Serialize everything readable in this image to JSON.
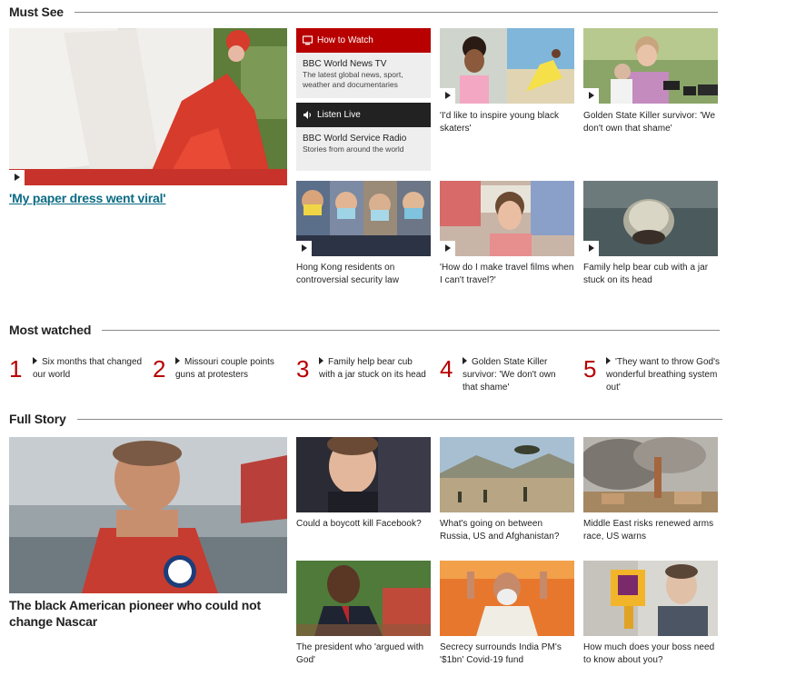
{
  "must_see": {
    "heading": "Must See",
    "feature": {
      "title": "'My paper dress went viral'"
    },
    "how_to_watch": {
      "label": "How to Watch",
      "title": "BBC World News TV",
      "subtitle": "The latest global news, sport, weather and documentaries"
    },
    "listen_live": {
      "label": "Listen Live",
      "title": "BBC World Service Radio",
      "subtitle": "Stories from around the world"
    },
    "items": [
      {
        "caption": "'I'd like to inspire young black skaters'"
      },
      {
        "caption": "Golden State Killer survivor: 'We don't own that shame'"
      },
      {
        "caption": "Hong Kong residents on controversial security law"
      },
      {
        "caption": "'How do I make travel films when I can't travel?'"
      },
      {
        "caption": "Family help bear cub with a jar stuck on its head"
      }
    ]
  },
  "most_watched": {
    "heading": "Most watched",
    "items": [
      {
        "rank": "1",
        "title": "Six months that changed our world"
      },
      {
        "rank": "2",
        "title": "Missouri couple points guns at protesters"
      },
      {
        "rank": "3",
        "title": "Family help bear cub with a jar stuck on its head"
      },
      {
        "rank": "4",
        "title": "Golden State Killer survivor: 'We don't own that shame'"
      },
      {
        "rank": "5",
        "title": "'They want to throw God's wonderful breathing system out'"
      }
    ]
  },
  "full_story": {
    "heading": "Full Story",
    "feature": {
      "title": "The black American pioneer who could not change Nascar"
    },
    "items": [
      {
        "caption": "Could a boycott kill Facebook?"
      },
      {
        "caption": "What's going on between Russia, US and Afghanistan?"
      },
      {
        "caption": "Middle East risks renewed arms race, US warns"
      },
      {
        "caption": "The president who 'argued with God'"
      },
      {
        "caption": "Secrecy surrounds India PM's '$1bn' Covid-19 fund"
      },
      {
        "caption": "How much does your boss need to know about you?"
      }
    ]
  },
  "colors": {
    "accent_red": "#b80000",
    "dark_bar": "#222222",
    "link_teal": "#0b6b84"
  },
  "icons": [
    "play-icon",
    "tv-icon",
    "speaker-icon",
    "triangle-bullet-icon"
  ]
}
